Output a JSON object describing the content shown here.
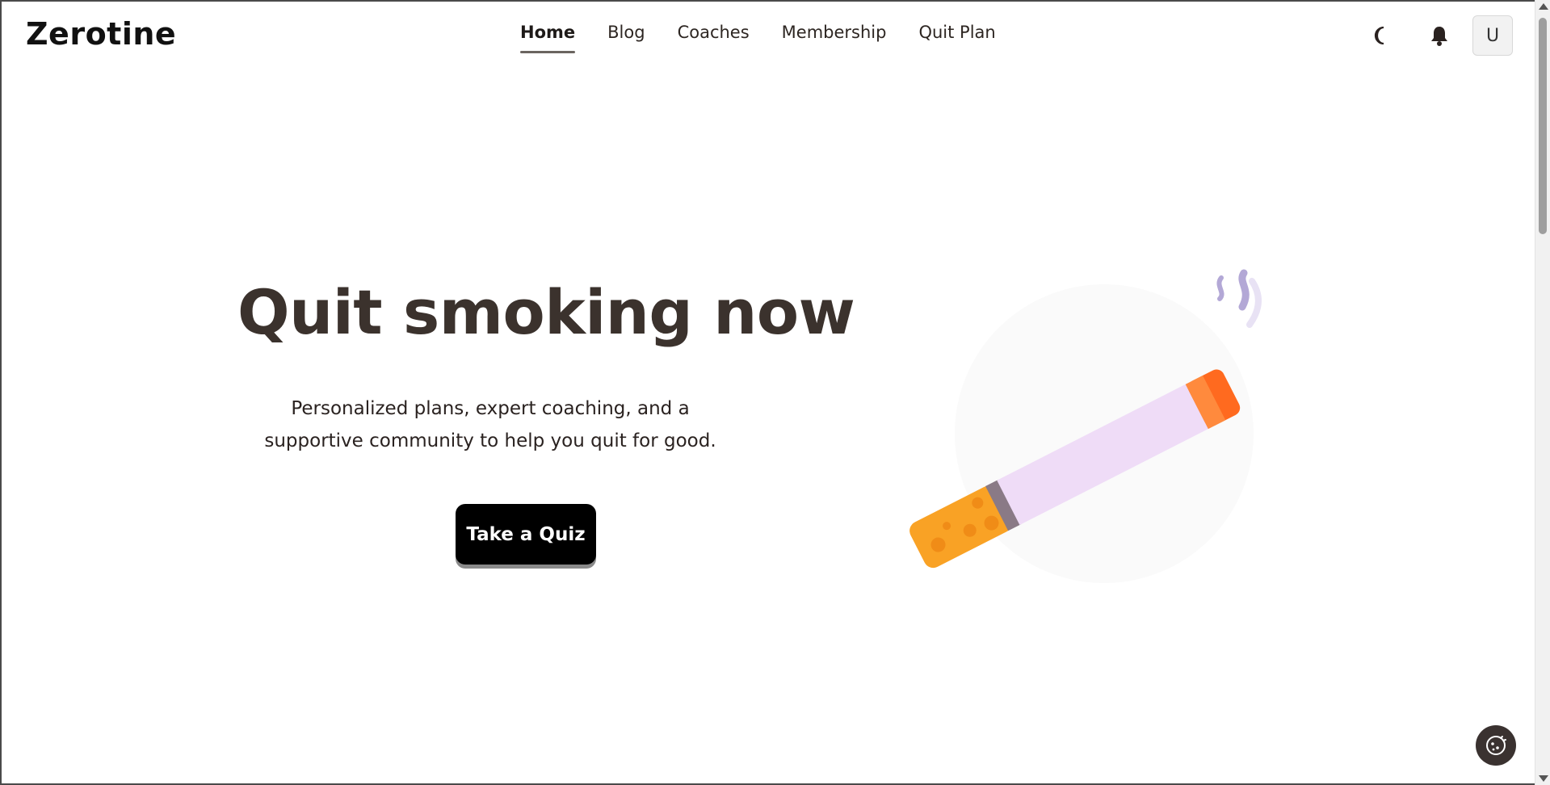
{
  "header": {
    "logo": "Zerotine",
    "nav": [
      {
        "label": "Home",
        "active": true
      },
      {
        "label": "Blog",
        "active": false
      },
      {
        "label": "Coaches",
        "active": false
      },
      {
        "label": "Membership",
        "active": false
      },
      {
        "label": "Quit Plan",
        "active": false
      }
    ],
    "theme_toggle_icon": "moon-icon",
    "notification_icon": "bell-icon",
    "avatar_initial": "U"
  },
  "hero": {
    "title": "Quit smoking now",
    "subtitle_line1": "Personalized plans, expert coaching, and a",
    "subtitle_line2": "supportive community to help you quit for good.",
    "cta_label": "Take a Quiz",
    "illustration": "cigarette-illustration"
  },
  "floating": {
    "chat_icon": "cookie-settings-icon"
  },
  "colors": {
    "text_dark": "#3b322d",
    "button_bg": "#000000",
    "cigarette_body": "#efdcf7",
    "filter": "#f9a225",
    "ember": "#ff6a1f",
    "smoke": "#b3a8d6"
  }
}
